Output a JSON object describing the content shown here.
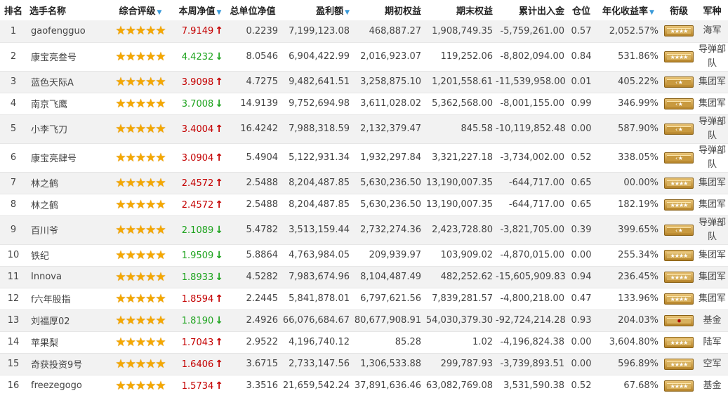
{
  "headers": {
    "rank": "排名",
    "name": "选手名称",
    "rating": "综合评级",
    "weekly": "本周净值",
    "unit": "总单位净值",
    "profit": "盈利额",
    "start_equity": "期初权益",
    "end_equity": "期末权益",
    "cumulative": "累计出入金",
    "position": "仓位",
    "annual": "年化收益率",
    "title_col": "衔级",
    "army": "军种"
  },
  "sort_arrow": "▼",
  "star_glyph": "★",
  "rows": [
    {
      "rank": "1",
      "name": "gaofengguo",
      "stars": 5,
      "weekly": "7.9149",
      "trend": "up",
      "unit": "0.2239",
      "profit": "7,199,123.08",
      "start": "468,887.27",
      "end": "1,908,749.35",
      "cum": "-5,759,261.00",
      "pos": "0.57",
      "annual": "2,052.57%",
      "badge": "stars",
      "army": "海军"
    },
    {
      "rank": "2",
      "name": "康宝亮叁号",
      "stars": 5,
      "weekly": "4.4232",
      "trend": "down",
      "unit": "8.0546",
      "profit": "6,904,422.99",
      "start": "2,016,923.07",
      "end": "119,252.06",
      "cum": "-8,802,094.00",
      "pos": "0.84",
      "annual": "531.86%",
      "badge": "stars",
      "army": "导弹部队"
    },
    {
      "rank": "3",
      "name": "蓝色天际A",
      "stars": 5,
      "weekly": "3.9098",
      "trend": "up",
      "unit": "4.7275",
      "profit": "9,482,641.51",
      "start": "3,258,875.10",
      "end": "1,201,558.61",
      "cum": "-11,539,958.00",
      "pos": "0.01",
      "annual": "405.22%",
      "badge": "chevron",
      "army": "集团军"
    },
    {
      "rank": "4",
      "name": "南京飞鹰",
      "stars": 5,
      "weekly": "3.7008",
      "trend": "down",
      "unit": "14.9139",
      "profit": "9,752,694.98",
      "start": "3,611,028.02",
      "end": "5,362,568.00",
      "cum": "-8,001,155.00",
      "pos": "0.99",
      "annual": "346.99%",
      "badge": "chevron",
      "army": "集团军"
    },
    {
      "rank": "5",
      "name": "小李飞刀",
      "stars": 5,
      "weekly": "3.4004",
      "trend": "up",
      "unit": "16.4242",
      "profit": "7,988,318.59",
      "start": "2,132,379.47",
      "end": "845.58",
      "cum": "-10,119,852.48",
      "pos": "0.00",
      "annual": "587.90%",
      "badge": "chevron",
      "army": "导弹部队"
    },
    {
      "rank": "6",
      "name": "康宝亮肆号",
      "stars": 5,
      "weekly": "3.0904",
      "trend": "up",
      "unit": "5.4904",
      "profit": "5,122,931.34",
      "start": "1,932,297.84",
      "end": "3,321,227.18",
      "cum": "-3,734,002.00",
      "pos": "0.52",
      "annual": "338.05%",
      "badge": "chevron",
      "army": "导弹部队"
    },
    {
      "rank": "7",
      "name": "林之鹤",
      "stars": 5,
      "weekly": "2.4572",
      "trend": "up",
      "unit": "2.5488",
      "profit": "8,204,487.85",
      "start": "5,630,236.50",
      "end": "13,190,007.35",
      "cum": "-644,717.00",
      "pos": "0.65",
      "annual": "00.00%",
      "badge": "stars",
      "army": "集团军"
    },
    {
      "rank": "8",
      "name": "林之鹤",
      "stars": 5,
      "weekly": "2.4572",
      "trend": "up",
      "unit": "2.5488",
      "profit": "8,204,487.85",
      "start": "5,630,236.50",
      "end": "13,190,007.35",
      "cum": "-644,717.00",
      "pos": "0.65",
      "annual": "182.19%",
      "badge": "stars",
      "army": "集团军"
    },
    {
      "rank": "9",
      "name": "百川爷",
      "stars": 5,
      "weekly": "2.1089",
      "trend": "down",
      "unit": "5.4782",
      "profit": "3,513,159.44",
      "start": "2,732,274.36",
      "end": "2,423,728.80",
      "cum": "-3,821,705.00",
      "pos": "0.39",
      "annual": "399.65%",
      "badge": "chevron",
      "army": "导弹部队"
    },
    {
      "rank": "10",
      "name": "铁纪",
      "stars": 5,
      "weekly": "1.9509",
      "trend": "down",
      "unit": "5.8864",
      "profit": "4,763,984.05",
      "start": "209,939.97",
      "end": "103,909.02",
      "cum": "-4,870,015.00",
      "pos": "0.00",
      "annual": "255.34%",
      "badge": "stars",
      "army": "集团军"
    },
    {
      "rank": "11",
      "name": "Innova",
      "stars": 5,
      "weekly": "1.8933",
      "trend": "down",
      "unit": "4.5282",
      "profit": "7,983,674.96",
      "start": "8,104,487.49",
      "end": "482,252.62",
      "cum": "-15,605,909.83",
      "pos": "0.94",
      "annual": "236.45%",
      "badge": "stars",
      "army": "集团军"
    },
    {
      "rank": "12",
      "name": "f六年股指",
      "stars": 5,
      "weekly": "1.8594",
      "trend": "up",
      "unit": "2.2445",
      "profit": "5,841,878.01",
      "start": "6,797,621.56",
      "end": "7,839,281.57",
      "cum": "-4,800,218.00",
      "pos": "0.47",
      "annual": "133.96%",
      "badge": "stars",
      "army": "集团军"
    },
    {
      "rank": "13",
      "name": "刘福厚02",
      "stars": 5,
      "weekly": "1.8190",
      "trend": "down",
      "unit": "2.4926",
      "profit": "66,076,684.67",
      "start": "80,677,908.91",
      "end": "54,030,379.30",
      "cum": "-92,724,214.28",
      "pos": "0.93",
      "annual": "204.03%",
      "badge": "special",
      "army": "基金"
    },
    {
      "rank": "14",
      "name": "苹果梨",
      "stars": 5,
      "weekly": "1.7043",
      "trend": "up",
      "unit": "2.9522",
      "profit": "4,196,740.12",
      "start": "85.28",
      "end": "1.02",
      "cum": "-4,196,824.38",
      "pos": "0.00",
      "annual": "3,604.80%",
      "badge": "stars",
      "army": "陆军"
    },
    {
      "rank": "15",
      "name": "奇获投资9号",
      "stars": 5,
      "weekly": "1.6406",
      "trend": "up",
      "unit": "3.6715",
      "profit": "2,733,147.56",
      "start": "1,306,533.88",
      "end": "299,787.93",
      "cum": "-3,739,893.51",
      "pos": "0.00",
      "annual": "596.89%",
      "badge": "stars",
      "army": "空军"
    },
    {
      "rank": "16",
      "name": "freezegogo",
      "stars": 5,
      "weekly": "1.5734",
      "trend": "up",
      "unit": "3.3516",
      "profit": "21,659,542.24",
      "start": "37,891,636.46",
      "end": "63,082,769.08",
      "cum": "3,531,590.38",
      "pos": "0.52",
      "annual": "67.68%",
      "badge": "stars",
      "army": "基金"
    }
  ]
}
